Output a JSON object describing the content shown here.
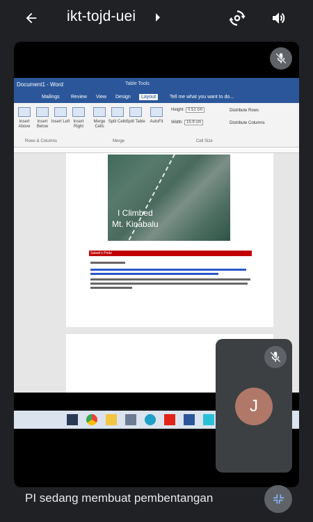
{
  "header": {
    "meeting_code": "ikt-tojd-uei",
    "icons": [
      "back-arrow-icon",
      "caret-right-icon",
      "switch-camera-icon",
      "speaker-icon"
    ]
  },
  "presentation": {
    "mic_state_icon": "mic-off-icon",
    "word": {
      "doc_title": "Document1 - Word",
      "context_tab": "Table Tools",
      "tabs": [
        "Mailings",
        "Review",
        "View",
        "Design",
        "Layout"
      ],
      "active_tab": "Layout",
      "tell_me": "Tell me what you want to do...",
      "ribbon_buttons": [
        "Insert Above",
        "Insert Below",
        "Insert Left",
        "Insert Right",
        "Merge Cells",
        "Split Cells",
        "Split Table",
        "AutoFit"
      ],
      "height_label": "Height:",
      "height_value": "0.51 cm",
      "width_label": "Width:",
      "width_value": "15.9 cm",
      "distribute_rows": "Distribute Rows",
      "distribute_columns": "Distribute Columns",
      "group_rows_columns": "Rows & Columns",
      "group_merge": "Merge",
      "group_cell_size": "Cell Size"
    },
    "document": {
      "photo_caption_line1": "I Climbed",
      "photo_caption_line2": "Mt. Kinabalu",
      "heading": "Sabah's Pride"
    }
  },
  "self_view": {
    "mic_state_icon": "mic-off-icon",
    "avatar_initial": "J",
    "avatar_color": "#b07868"
  },
  "footer": {
    "status": "PI sedang membuat pembentangan",
    "minimize_icon": "minimize-icon"
  }
}
